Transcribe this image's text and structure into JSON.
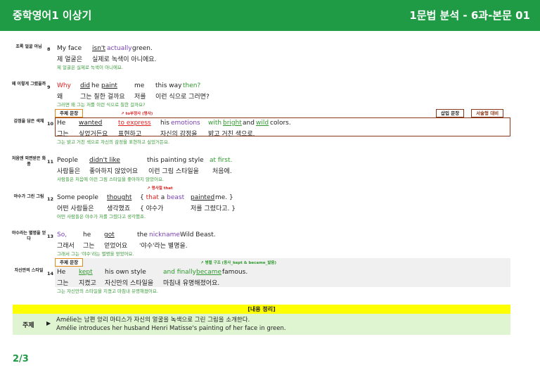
{
  "header": {
    "title": "중학영어1 이상기",
    "section": "1문법 분석 - 6과-본문 01"
  },
  "rows": [
    {
      "side": "초록 얼굴 아님",
      "num": "8",
      "en": [
        "My face",
        "isn't",
        "actually",
        "green."
      ],
      "ko": [
        "제 얼굴은",
        "실제로 녹색이 아니에요."
      ],
      "tr": "제 얼굴은 실제로 녹색이 아니에요."
    },
    {
      "side": "왜 이렇게 그렸을까",
      "num": "9",
      "en": [
        "Why",
        "did",
        "he",
        "paint",
        "me",
        "this way",
        "then?"
      ],
      "ko": [
        "왜",
        "그는 칠한 걸까요",
        "저를",
        "이런 식으로 그러면?"
      ],
      "tr": "그러면 왜 그는 저를 이런 식으로 칠한 걸까요?"
    },
    {
      "side": "감정을 담은 색채",
      "num": "10",
      "en": [
        "He",
        "wanted",
        "to express",
        "his",
        "emotions",
        "with",
        "bright",
        "and",
        "wild",
        "colors."
      ],
      "ko": [
        "그는",
        "싶었거든요",
        "표현하고",
        "자신의 감정을",
        "밝고 거친 색으로."
      ],
      "tr": "그는 밝고 거친 색으로 자신의 감정을 표현하고 싶었거든요.",
      "tags": {
        "theme": "주제 문장",
        "note": "to부정사 (명사)",
        "insert": "삽입 문장",
        "compare": "서술형 대비"
      }
    },
    {
      "side": "처음엔 외면받은 화풍",
      "num": "11",
      "en": [
        "People",
        "didn't like",
        "this painting style",
        "at first."
      ],
      "ko": [
        "사람들은",
        "좋아하지 않았어요",
        "이런 그림 스타일을",
        "처음에."
      ],
      "tr": "사람들은 처음에 이런 그림 스타일을 좋아하지 않았어요."
    },
    {
      "side": "야수가 그린 그림",
      "num": "12",
      "en": [
        "Some people",
        "thought",
        "{ that a beast",
        "painted",
        "me. }"
      ],
      "ko": [
        "어떤 사람들은",
        "생각했죠",
        "{ 야수가",
        "저를 그렸다고. }"
      ],
      "tr": "어떤 사람들은 야수가 저를 그렸다고 생각했죠.",
      "note": "명사절 that"
    },
    {
      "side": "야수라는 별명을 얻다",
      "num": "13",
      "en": [
        "So,",
        "he",
        "got",
        "the",
        "nickname",
        "Wild Beast."
      ],
      "ko": [
        "그래서",
        "그는",
        "얻었어요",
        "'야수'라는 별명을."
      ],
      "tr": "그래서 그는 '야수'라는 별명을 얻었어요."
    },
    {
      "side": "자신만의 스타일",
      "num": "14",
      "en": [
        "He",
        "kept",
        "his own style",
        "and finally",
        "became",
        "famous."
      ],
      "ko": [
        "그는",
        "지켰고",
        "자신만의 스타일을",
        "마침내 유명해졌어요."
      ],
      "tr": "그는 자신만의 스타일을 지켰고 마침내 유명해졌어요.",
      "tags": {
        "theme": "주제 문장",
        "note": "병렬 구조 (동사_kept & became_발음)"
      }
    }
  ],
  "summary": {
    "title": "[내용 정리]",
    "label": "주제",
    "arrow": "▶",
    "ko": "Amélie는 남편 앙리 마티스가 자신의 얼굴을 녹색으로 그린 그림을 소개한다.",
    "en": "Amélie introduces her husband Henri Matisse's painting of her face in green."
  },
  "page": "2/3",
  "colors": {
    "brand": "#1f9b46",
    "purple": "#7a3fb5",
    "green": "#2e9a2e",
    "red": "#e02020",
    "tag_border": "#e08a1e",
    "box": "#8a3a1a",
    "summary_title_bg": "#ffff00",
    "summary_bg": "#dff5d2"
  }
}
